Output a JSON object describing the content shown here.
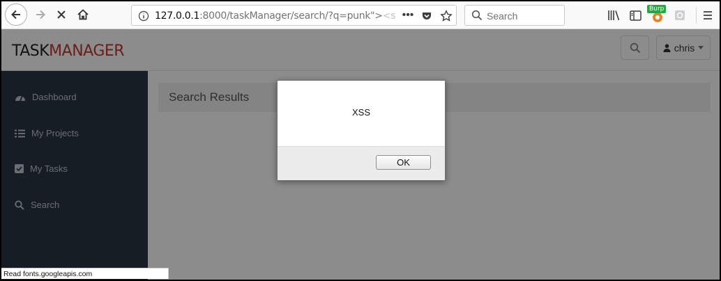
{
  "browser": {
    "url_host": "127.0.0.1",
    "url_rest": ":8000/taskManager/search/?q=punk\">",
    "url_faded": "<s",
    "search_placeholder": "Search",
    "burp_badge": "Burp"
  },
  "app": {
    "logo_task": "TASK",
    "logo_manager": "MANAGER",
    "user_name": "chris",
    "sidebar": [
      {
        "label": "Dashboard",
        "icon": "dashboard-icon"
      },
      {
        "label": "My Projects",
        "icon": "list-icon"
      },
      {
        "label": "My Tasks",
        "icon": "checkbox-icon"
      },
      {
        "label": "Search",
        "icon": "search-icon"
      }
    ],
    "page_title": "Search Results"
  },
  "dialog": {
    "message": "XSS",
    "ok_label": "OK"
  },
  "status_text": "Read fonts.googleapis.com",
  "colors": {
    "brand_red": "#c0392b",
    "sidebar_bg": "#2b3643",
    "burp_green": "#27a844"
  }
}
